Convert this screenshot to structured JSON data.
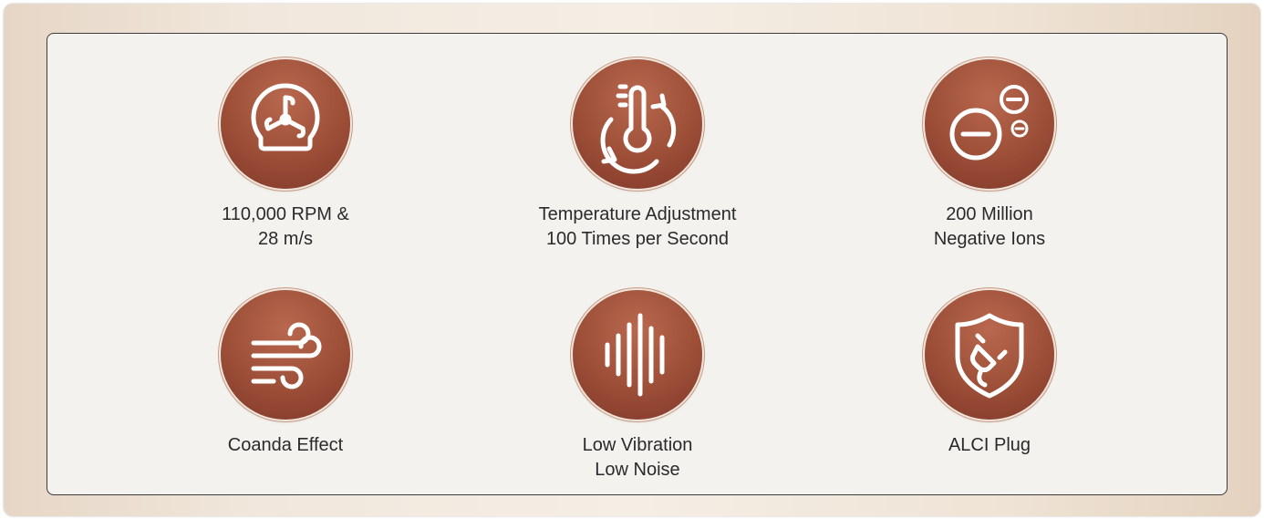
{
  "features": [
    {
      "icon": "fan-gauge-icon",
      "lines": [
        "110,000 RPM &",
        "28 m/s"
      ]
    },
    {
      "icon": "thermometer-cycle-icon",
      "lines": [
        "Temperature Adjustment",
        "100 Times per Second"
      ]
    },
    {
      "icon": "negative-ions-icon",
      "lines": [
        "200 Million",
        "Negative Ions"
      ]
    },
    {
      "icon": "wind-icon",
      "lines": [
        "Coanda Effect"
      ]
    },
    {
      "icon": "sound-wave-icon",
      "lines": [
        "Low Vibration",
        "Low Noise"
      ]
    },
    {
      "icon": "shield-plug-icon",
      "lines": [
        "ALCI Plug"
      ]
    }
  ],
  "colors": {
    "badge": "#9c4e37",
    "text": "#2a2a2a",
    "panel": "#f4f2ee"
  }
}
